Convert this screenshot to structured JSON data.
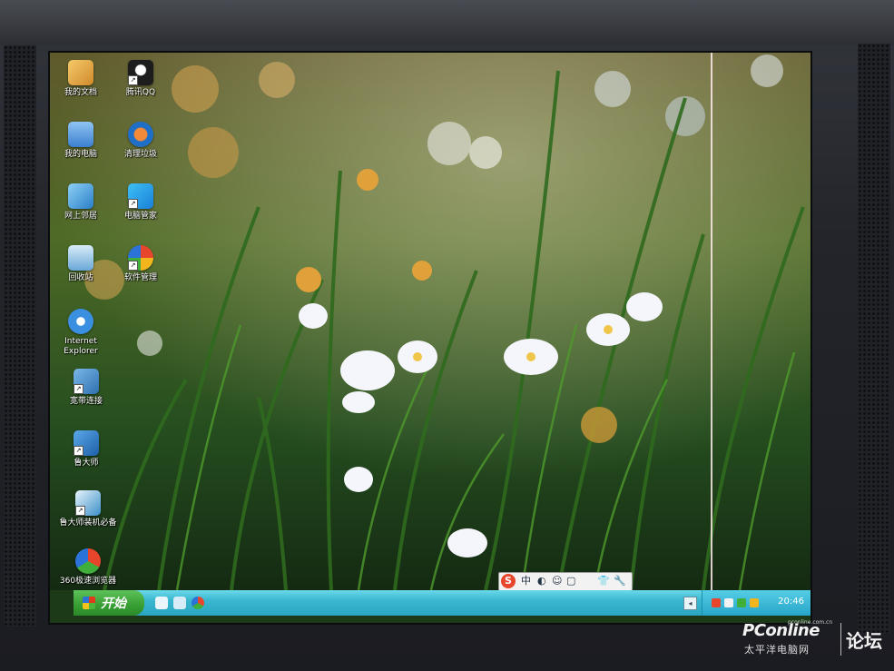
{
  "desktop": {
    "icons": [
      {
        "label": "我的文档",
        "color": "#e2a53a"
      },
      {
        "label": "腾讯QQ",
        "color": "#1d1d1d"
      },
      {
        "label": "我的电脑",
        "color": "#4f8fd8"
      },
      {
        "label": "清理垃圾",
        "color": "#1f6fc8"
      },
      {
        "label": "网上邻居",
        "color": "#3b8fd0"
      },
      {
        "label": "电脑管家",
        "color": "#1e9be0"
      },
      {
        "label": "回收站",
        "color": "#5fa8d8"
      },
      {
        "label": "软件管理",
        "color": "#e25a3a"
      },
      {
        "label": "Internet Explorer",
        "color": "#3a8fe0"
      },
      {
        "label": "宽带连接",
        "color": "#3a7fc0"
      },
      {
        "label": "鲁大师",
        "color": "#2a6fb8"
      },
      {
        "label": "鲁大师装机必备",
        "color": "#2f88c8"
      },
      {
        "label": "360极速浏览器",
        "color": "#d04a3a"
      }
    ]
  },
  "ime_toolbar": {
    "logo": "S",
    "mode": "中",
    "cells": [
      "◐",
      "☺",
      "▢",
      "👕",
      "🔧"
    ]
  },
  "taskbar": {
    "start_label": "开始",
    "clock": "20:46",
    "colors": {
      "start": "#379e33",
      "bar": "#3ab7d0"
    }
  },
  "watermark": {
    "brand": "PConline",
    "site": "pconline.com.cn",
    "sub": "太平洋电脑网",
    "forum": "论坛"
  }
}
